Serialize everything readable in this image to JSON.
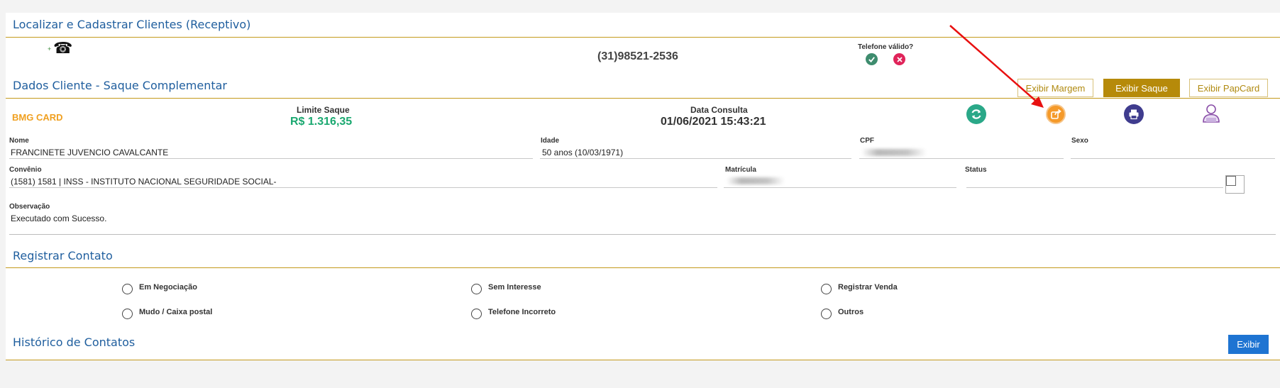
{
  "header": {
    "title": "Localizar e Cadastrar Clientes (Receptivo)"
  },
  "phone": {
    "number": "(31)98521-2536",
    "valid_label": "Telefone válido?",
    "add_symbol": "+",
    "phone_glyph": "☎"
  },
  "client_section": {
    "title": "Dados Cliente - Saque Complementar",
    "tabs": [
      {
        "label": "Exibir Margem",
        "active": false
      },
      {
        "label": "Exibir Saque",
        "active": true
      },
      {
        "label": "Exibir PapCard",
        "active": false
      }
    ]
  },
  "summary": {
    "product": "BMG CARD",
    "limit_label": "Limite Saque",
    "limit_value": "R$ 1.316,35",
    "date_label": "Data Consulta",
    "date_value": "01/06/2021 15:43:21"
  },
  "fields": {
    "nome": {
      "label": "Nome",
      "value": "FRANCINETE JUVENCIO CAVALCANTE"
    },
    "idade": {
      "label": "Idade",
      "value": "50 anos (10/03/1971)"
    },
    "cpf": {
      "label": "CPF",
      "value": ""
    },
    "sexo": {
      "label": "Sexo",
      "value": ""
    },
    "convenio": {
      "label": "Convênio",
      "value": "(1581) 1581 | INSS - INSTITUTO NACIONAL SEGURIDADE SOCIAL-"
    },
    "matricula": {
      "label": "Matrícula",
      "value": ""
    },
    "status": {
      "label": "Status",
      "value": ""
    },
    "observacao": {
      "label": "Observação",
      "value": "Executado com Sucesso."
    }
  },
  "contact": {
    "title": "Registrar Contato",
    "options": [
      "Em Negociação",
      "Sem Interesse",
      "Registrar Venda",
      "Mudo / Caixa postal",
      "Telefone Incorreto",
      "Outros"
    ]
  },
  "history": {
    "title": "Histórico de Contatos",
    "button": "Exibir"
  },
  "colors": {
    "accent_gold": "#b68a0a",
    "title_blue": "#1f5e9e",
    "product_orange": "#f0a020",
    "limit_green": "#1aa870",
    "button_blue": "#1e74d2",
    "annotation_red": "#e81010"
  },
  "icons": [
    "phone-icon",
    "check-icon",
    "close-icon",
    "refresh-icon",
    "share-icon",
    "printer-icon",
    "user-icon",
    "red-arrow-annotation"
  ]
}
